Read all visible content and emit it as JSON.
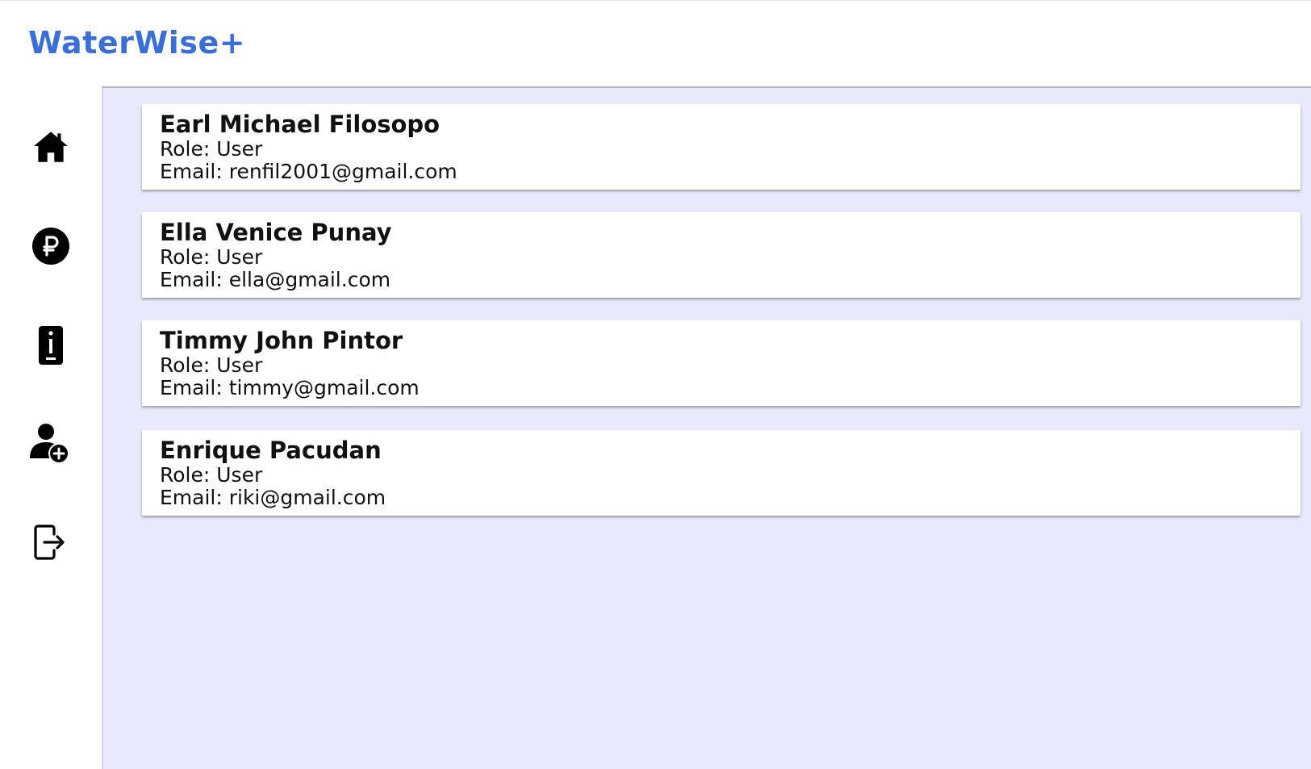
{
  "app": {
    "title": "WaterWise+",
    "brand_color": "#3a6fd8",
    "content_background": "#e8e9fb"
  },
  "sidebar": {
    "items": [
      {
        "icon": "home-icon"
      },
      {
        "icon": "peso-coin-icon"
      },
      {
        "icon": "info-icon"
      },
      {
        "icon": "add-user-icon"
      },
      {
        "icon": "logout-icon"
      }
    ]
  },
  "users": [
    {
      "name": "Earl Michael Filosopo",
      "role": "Role: User",
      "email": "Email: renfil2001@gmail.com"
    },
    {
      "name": "Ella Venice Punay",
      "role": "Role: User",
      "email": "Email: ella@gmail.com"
    },
    {
      "name": "Timmy John Pintor",
      "role": "Role: User",
      "email": "Email: timmy@gmail.com"
    },
    {
      "name": "Enrique Pacudan",
      "role": "Role: User",
      "email": "Email: riki@gmail.com"
    }
  ]
}
